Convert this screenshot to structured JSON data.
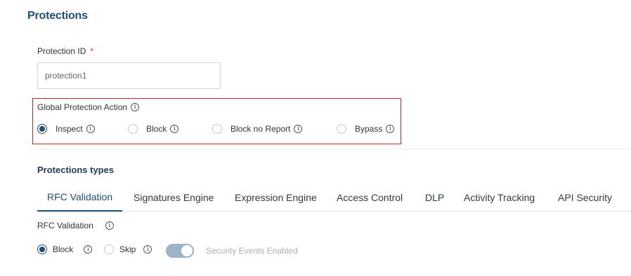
{
  "page": {
    "title": "Protections"
  },
  "protection_id": {
    "label": "Protection ID",
    "required_mark": "*",
    "value": "protection1"
  },
  "global_action": {
    "label": "Global Protection Action",
    "options": [
      {
        "label": "Inspect",
        "checked": true
      },
      {
        "label": "Block",
        "checked": false
      },
      {
        "label": "Block no Report",
        "checked": false
      },
      {
        "label": "Bypass",
        "checked": false
      }
    ]
  },
  "protection_types": {
    "title": "Protections types",
    "tabs": [
      {
        "label": "RFC Validation",
        "active": true
      },
      {
        "label": "Signatures Engine",
        "active": false
      },
      {
        "label": "Expression Engine",
        "active": false
      },
      {
        "label": "Access Control",
        "active": false
      },
      {
        "label": "DLP",
        "active": false
      },
      {
        "label": "Activity Tracking",
        "active": false
      },
      {
        "label": "API Security",
        "active": false
      }
    ]
  },
  "rfc": {
    "label": "RFC Validation",
    "options": [
      {
        "label": "Block",
        "checked": true
      },
      {
        "label": "Skip",
        "checked": false
      }
    ],
    "toggle_label": "Security Events Enabled",
    "toggle_on": true
  },
  "colors": {
    "accent": "#1f4e79",
    "highlight_border": "#c0282d",
    "required": "#e03131"
  }
}
